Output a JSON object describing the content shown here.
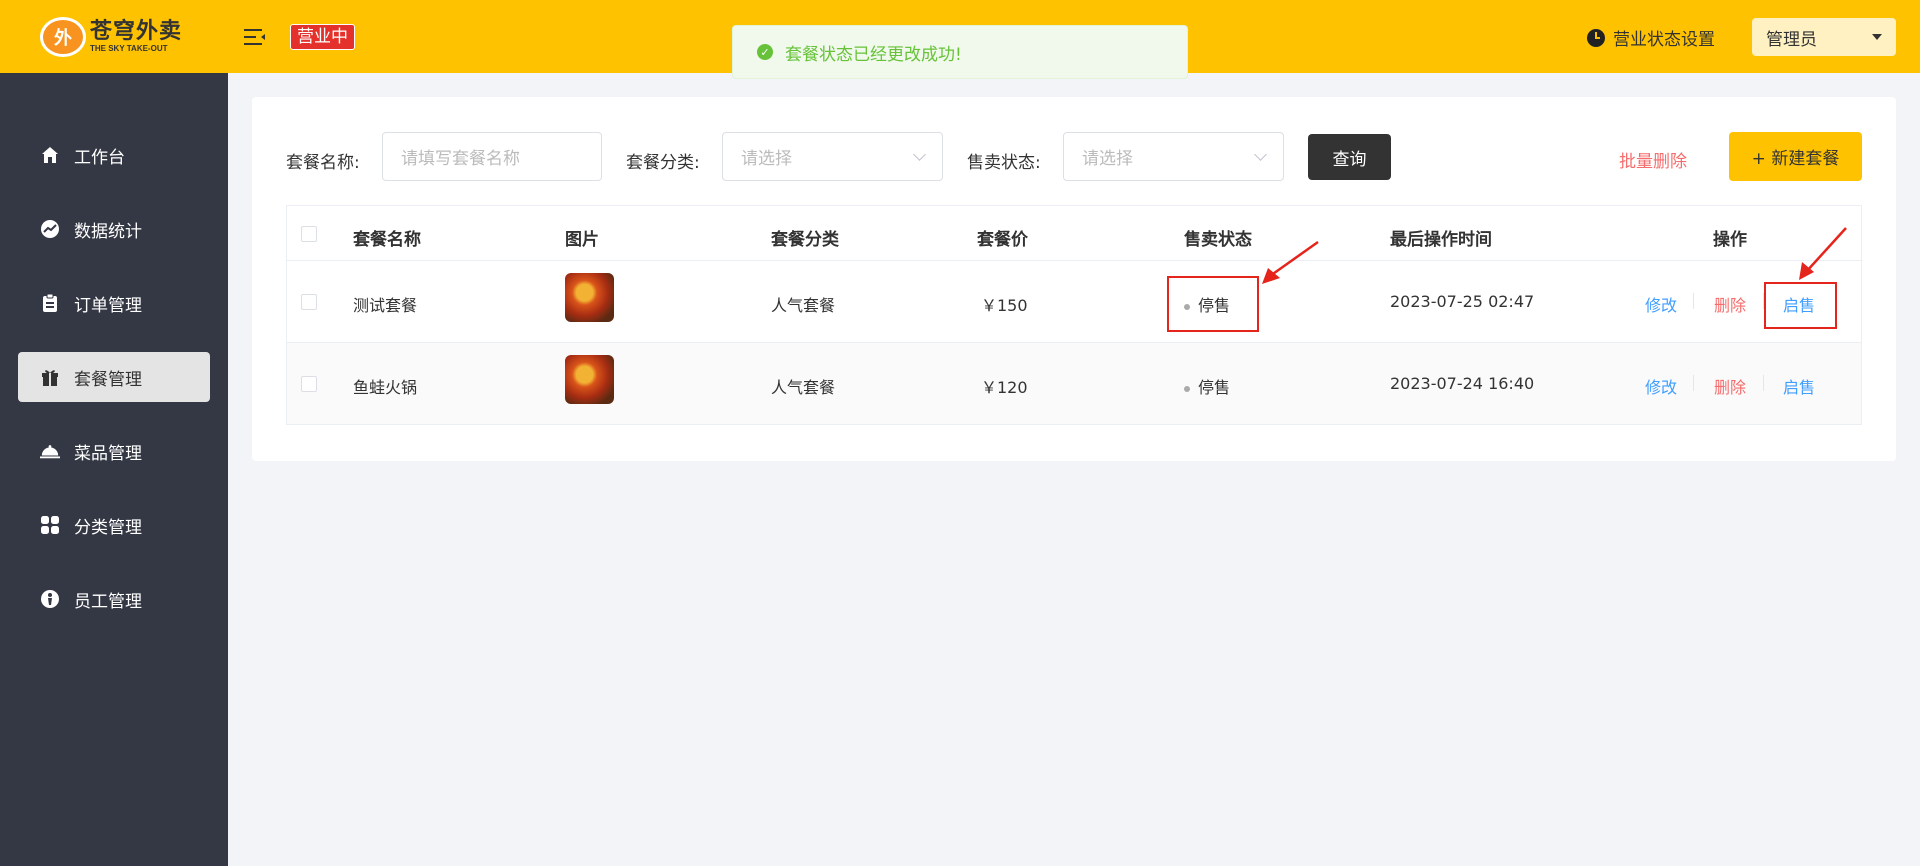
{
  "header": {
    "logo_cn": "苍穹外卖",
    "logo_en": "THE SKY TAKE-OUT",
    "status_tag": "营业中",
    "biz_setting_label": "营业状态设置",
    "user_label": "管理员",
    "toast_message": "套餐状态已经更改成功!"
  },
  "sidebar": {
    "items": [
      {
        "label": "工作台",
        "icon": "home-icon"
      },
      {
        "label": "数据统计",
        "icon": "chart-icon"
      },
      {
        "label": "订单管理",
        "icon": "clipboard-icon"
      },
      {
        "label": "套餐管理",
        "icon": "gift-icon"
      },
      {
        "label": "菜品管理",
        "icon": "dish-icon"
      },
      {
        "label": "分类管理",
        "icon": "grid-icon"
      },
      {
        "label": "员工管理",
        "icon": "employee-icon"
      }
    ],
    "active_index": 3
  },
  "filters": {
    "name_label": "套餐名称:",
    "name_placeholder": "请填写套餐名称",
    "category_label": "套餐分类:",
    "category_placeholder": "请选择",
    "status_label": "售卖状态:",
    "status_placeholder": "请选择",
    "query_button": "查询",
    "batch_delete_button": "批量删除",
    "new_button": "+ 新建套餐"
  },
  "table": {
    "headers": [
      "套餐名称",
      "图片",
      "套餐分类",
      "套餐价",
      "售卖状态",
      "最后操作时间",
      "操作"
    ],
    "rows": [
      {
        "name": "测试套餐",
        "category": "人气套餐",
        "price": "￥150",
        "status": "停售",
        "time": "2023-07-25 02:47",
        "op_edit": "修改",
        "op_delete": "删除",
        "op_sale": "启售"
      },
      {
        "name": "鱼蛙火锅",
        "category": "人气套餐",
        "price": "￥120",
        "status": "停售",
        "time": "2023-07-24 16:40",
        "op_edit": "修改",
        "op_delete": "删除",
        "op_sale": "启售"
      }
    ]
  },
  "colors": {
    "brand": "#ffc200",
    "sidebar": "#343744",
    "link": "#419eff",
    "danger": "#f56c6c",
    "success": "#67c23a",
    "annotation": "#e5241c"
  }
}
